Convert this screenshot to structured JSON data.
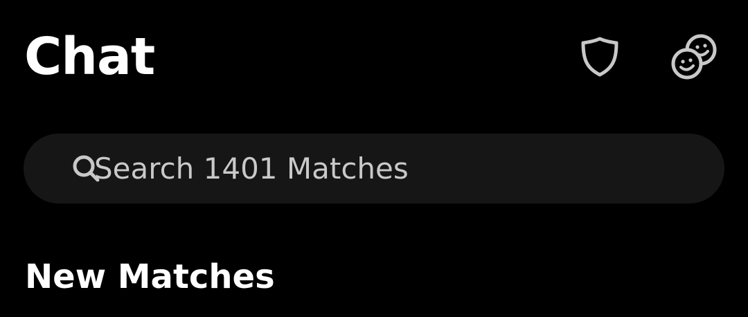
{
  "header": {
    "title": "Chat",
    "shield_icon": "shield-icon",
    "matches_icon": "double-smiley-icon"
  },
  "search": {
    "placeholder": "Search 1401 Matches",
    "value": ""
  },
  "sections": {
    "new_matches_title": "New Matches"
  },
  "colors": {
    "background": "#000000",
    "search_bg": "#161616",
    "icon_stroke": "#c8c8c8",
    "text_primary": "#ffffff",
    "text_placeholder": "#c9c9c9"
  }
}
